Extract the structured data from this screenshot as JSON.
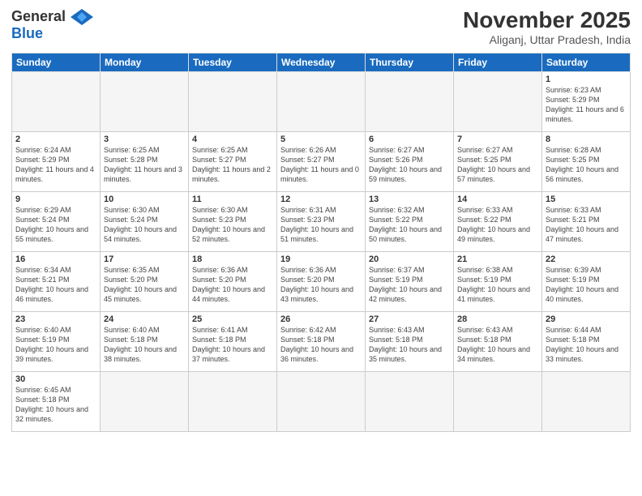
{
  "logo": {
    "general": "General",
    "blue": "Blue"
  },
  "title": "November 2025",
  "subtitle": "Aliganj, Uttar Pradesh, India",
  "days_of_week": [
    "Sunday",
    "Monday",
    "Tuesday",
    "Wednesday",
    "Thursday",
    "Friday",
    "Saturday"
  ],
  "weeks": [
    [
      {
        "day": "",
        "info": ""
      },
      {
        "day": "",
        "info": ""
      },
      {
        "day": "",
        "info": ""
      },
      {
        "day": "",
        "info": ""
      },
      {
        "day": "",
        "info": ""
      },
      {
        "day": "",
        "info": ""
      },
      {
        "day": "1",
        "info": "Sunrise: 6:23 AM\nSunset: 5:29 PM\nDaylight: 11 hours\nand 6 minutes."
      }
    ],
    [
      {
        "day": "2",
        "info": "Sunrise: 6:24 AM\nSunset: 5:29 PM\nDaylight: 11 hours\nand 4 minutes."
      },
      {
        "day": "3",
        "info": "Sunrise: 6:25 AM\nSunset: 5:28 PM\nDaylight: 11 hours\nand 3 minutes."
      },
      {
        "day": "4",
        "info": "Sunrise: 6:25 AM\nSunset: 5:27 PM\nDaylight: 11 hours\nand 2 minutes."
      },
      {
        "day": "5",
        "info": "Sunrise: 6:26 AM\nSunset: 5:27 PM\nDaylight: 11 hours\nand 0 minutes."
      },
      {
        "day": "6",
        "info": "Sunrise: 6:27 AM\nSunset: 5:26 PM\nDaylight: 10 hours\nand 59 minutes."
      },
      {
        "day": "7",
        "info": "Sunrise: 6:27 AM\nSunset: 5:25 PM\nDaylight: 10 hours\nand 57 minutes."
      },
      {
        "day": "8",
        "info": "Sunrise: 6:28 AM\nSunset: 5:25 PM\nDaylight: 10 hours\nand 56 minutes."
      }
    ],
    [
      {
        "day": "9",
        "info": "Sunrise: 6:29 AM\nSunset: 5:24 PM\nDaylight: 10 hours\nand 55 minutes."
      },
      {
        "day": "10",
        "info": "Sunrise: 6:30 AM\nSunset: 5:24 PM\nDaylight: 10 hours\nand 54 minutes."
      },
      {
        "day": "11",
        "info": "Sunrise: 6:30 AM\nSunset: 5:23 PM\nDaylight: 10 hours\nand 52 minutes."
      },
      {
        "day": "12",
        "info": "Sunrise: 6:31 AM\nSunset: 5:23 PM\nDaylight: 10 hours\nand 51 minutes."
      },
      {
        "day": "13",
        "info": "Sunrise: 6:32 AM\nSunset: 5:22 PM\nDaylight: 10 hours\nand 50 minutes."
      },
      {
        "day": "14",
        "info": "Sunrise: 6:33 AM\nSunset: 5:22 PM\nDaylight: 10 hours\nand 49 minutes."
      },
      {
        "day": "15",
        "info": "Sunrise: 6:33 AM\nSunset: 5:21 PM\nDaylight: 10 hours\nand 47 minutes."
      }
    ],
    [
      {
        "day": "16",
        "info": "Sunrise: 6:34 AM\nSunset: 5:21 PM\nDaylight: 10 hours\nand 46 minutes."
      },
      {
        "day": "17",
        "info": "Sunrise: 6:35 AM\nSunset: 5:20 PM\nDaylight: 10 hours\nand 45 minutes."
      },
      {
        "day": "18",
        "info": "Sunrise: 6:36 AM\nSunset: 5:20 PM\nDaylight: 10 hours\nand 44 minutes."
      },
      {
        "day": "19",
        "info": "Sunrise: 6:36 AM\nSunset: 5:20 PM\nDaylight: 10 hours\nand 43 minutes."
      },
      {
        "day": "20",
        "info": "Sunrise: 6:37 AM\nSunset: 5:19 PM\nDaylight: 10 hours\nand 42 minutes."
      },
      {
        "day": "21",
        "info": "Sunrise: 6:38 AM\nSunset: 5:19 PM\nDaylight: 10 hours\nand 41 minutes."
      },
      {
        "day": "22",
        "info": "Sunrise: 6:39 AM\nSunset: 5:19 PM\nDaylight: 10 hours\nand 40 minutes."
      }
    ],
    [
      {
        "day": "23",
        "info": "Sunrise: 6:40 AM\nSunset: 5:19 PM\nDaylight: 10 hours\nand 39 minutes."
      },
      {
        "day": "24",
        "info": "Sunrise: 6:40 AM\nSunset: 5:18 PM\nDaylight: 10 hours\nand 38 minutes."
      },
      {
        "day": "25",
        "info": "Sunrise: 6:41 AM\nSunset: 5:18 PM\nDaylight: 10 hours\nand 37 minutes."
      },
      {
        "day": "26",
        "info": "Sunrise: 6:42 AM\nSunset: 5:18 PM\nDaylight: 10 hours\nand 36 minutes."
      },
      {
        "day": "27",
        "info": "Sunrise: 6:43 AM\nSunset: 5:18 PM\nDaylight: 10 hours\nand 35 minutes."
      },
      {
        "day": "28",
        "info": "Sunrise: 6:43 AM\nSunset: 5:18 PM\nDaylight: 10 hours\nand 34 minutes."
      },
      {
        "day": "29",
        "info": "Sunrise: 6:44 AM\nSunset: 5:18 PM\nDaylight: 10 hours\nand 33 minutes."
      }
    ],
    [
      {
        "day": "30",
        "info": "Sunrise: 6:45 AM\nSunset: 5:18 PM\nDaylight: 10 hours\nand 32 minutes."
      },
      {
        "day": "",
        "info": ""
      },
      {
        "day": "",
        "info": ""
      },
      {
        "day": "",
        "info": ""
      },
      {
        "day": "",
        "info": ""
      },
      {
        "day": "",
        "info": ""
      },
      {
        "day": "",
        "info": ""
      }
    ]
  ]
}
